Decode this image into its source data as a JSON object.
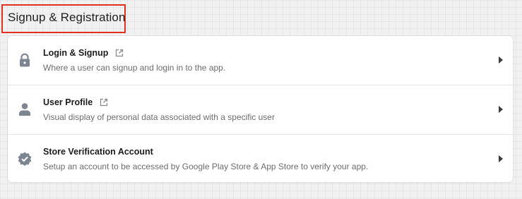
{
  "section": {
    "title": "Signup & Registration"
  },
  "items": [
    {
      "title": "Login & Signup",
      "description": "Where a user can signup and login in to the app.",
      "icon": "lock-icon",
      "has_external_link": true
    },
    {
      "title": "User Profile",
      "description": "Visual display of personal data associated with a specific user",
      "icon": "user-icon",
      "has_external_link": true
    },
    {
      "title": "Store Verification Account",
      "description": "Setup an account to be accessed by Google Play Store & App Store to verify your app.",
      "icon": "verified-badge-icon",
      "has_external_link": false
    }
  ],
  "colors": {
    "highlight_border": "#e0301e",
    "icon_gray": "#7d8591",
    "external_link_gray": "#8a8a8a"
  }
}
